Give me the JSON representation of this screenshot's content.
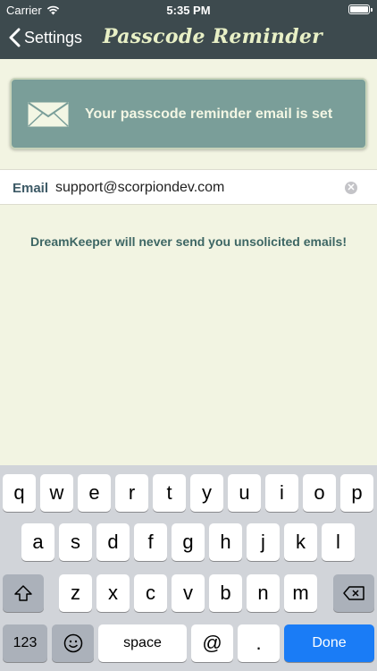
{
  "status": {
    "carrier": "Carrier",
    "time": "5:35 PM"
  },
  "nav": {
    "back_label": "Settings",
    "title": "Passcode Reminder"
  },
  "banner": {
    "message": "Your passcode reminder email is set"
  },
  "email": {
    "label": "Email",
    "value": "support@scorpiondev.com"
  },
  "note": "DreamKeeper will never send you unsolicited emails!",
  "keyboard": {
    "row1": [
      "q",
      "w",
      "e",
      "r",
      "t",
      "y",
      "u",
      "i",
      "o",
      "p"
    ],
    "row2": [
      "a",
      "s",
      "d",
      "f",
      "g",
      "h",
      "j",
      "k",
      "l"
    ],
    "row3": [
      "z",
      "x",
      "c",
      "v",
      "b",
      "n",
      "m"
    ],
    "numbers_label": "123",
    "space_label": "space",
    "at_label": "@",
    "period_label": ".",
    "done_label": "Done"
  },
  "colors": {
    "nav": "#3d4a4e",
    "background": "#f2f4e2",
    "banner": "#7a9e99",
    "done": "#1a7cf6"
  }
}
